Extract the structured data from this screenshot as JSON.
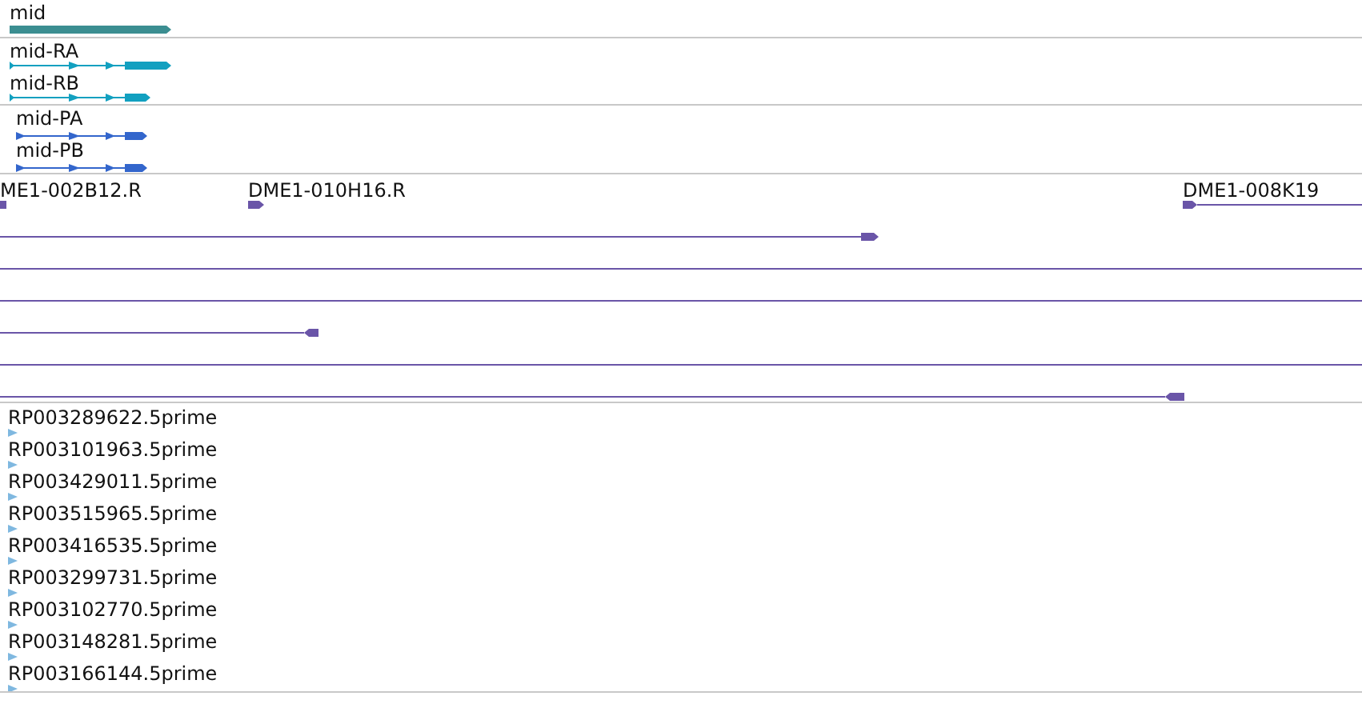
{
  "tracks": [
    {
      "kind": "gene",
      "color": "#3b8e91",
      "features": [
        {
          "label": "mid",
          "reverse": false
        }
      ]
    },
    {
      "kind": "transcript",
      "color": "#12a0c0",
      "features": [
        {
          "label": "mid-RA",
          "reverse": false
        },
        {
          "label": "mid-RB",
          "reverse": false
        }
      ]
    },
    {
      "kind": "transcript",
      "color": "#3366cc",
      "features": [
        {
          "label": "mid-PA",
          "reverse": false
        },
        {
          "label": "mid-PB",
          "reverse": false
        }
      ]
    },
    {
      "kind": "clone",
      "color": "#6a55a8",
      "features": [
        {
          "kind": "clone",
          "label": "ME1-002B12.R"
        },
        {
          "kind": "clone",
          "label": "DME1-010H16.R",
          "reverse": false
        },
        {
          "kind": "clone",
          "label": "DME1-008K19",
          "reverse": false
        },
        {
          "kind": "clone",
          "reverse": false
        },
        {
          "kind": "span"
        },
        {
          "kind": "span"
        },
        {
          "kind": "clone",
          "reverse": true
        },
        {
          "kind": "span"
        },
        {
          "kind": "clone",
          "reverse": true
        }
      ]
    },
    {
      "kind": "est",
      "color": "#7fb8e0",
      "features": [
        {
          "label": "RP003289622.5prime",
          "reverse": false
        },
        {
          "label": "RP003101963.5prime",
          "reverse": false
        },
        {
          "label": "RP003429011.5prime",
          "reverse": false
        },
        {
          "label": "RP003515965.5prime",
          "reverse": false
        },
        {
          "label": "RP003416535.5prime",
          "reverse": false
        },
        {
          "label": "RP003299731.5prime",
          "reverse": false
        },
        {
          "label": "RP003102770.5prime",
          "reverse": false
        },
        {
          "label": "RP003148281.5prime",
          "reverse": false
        },
        {
          "label": "RP003166144.5prime",
          "reverse": false
        }
      ]
    }
  ]
}
